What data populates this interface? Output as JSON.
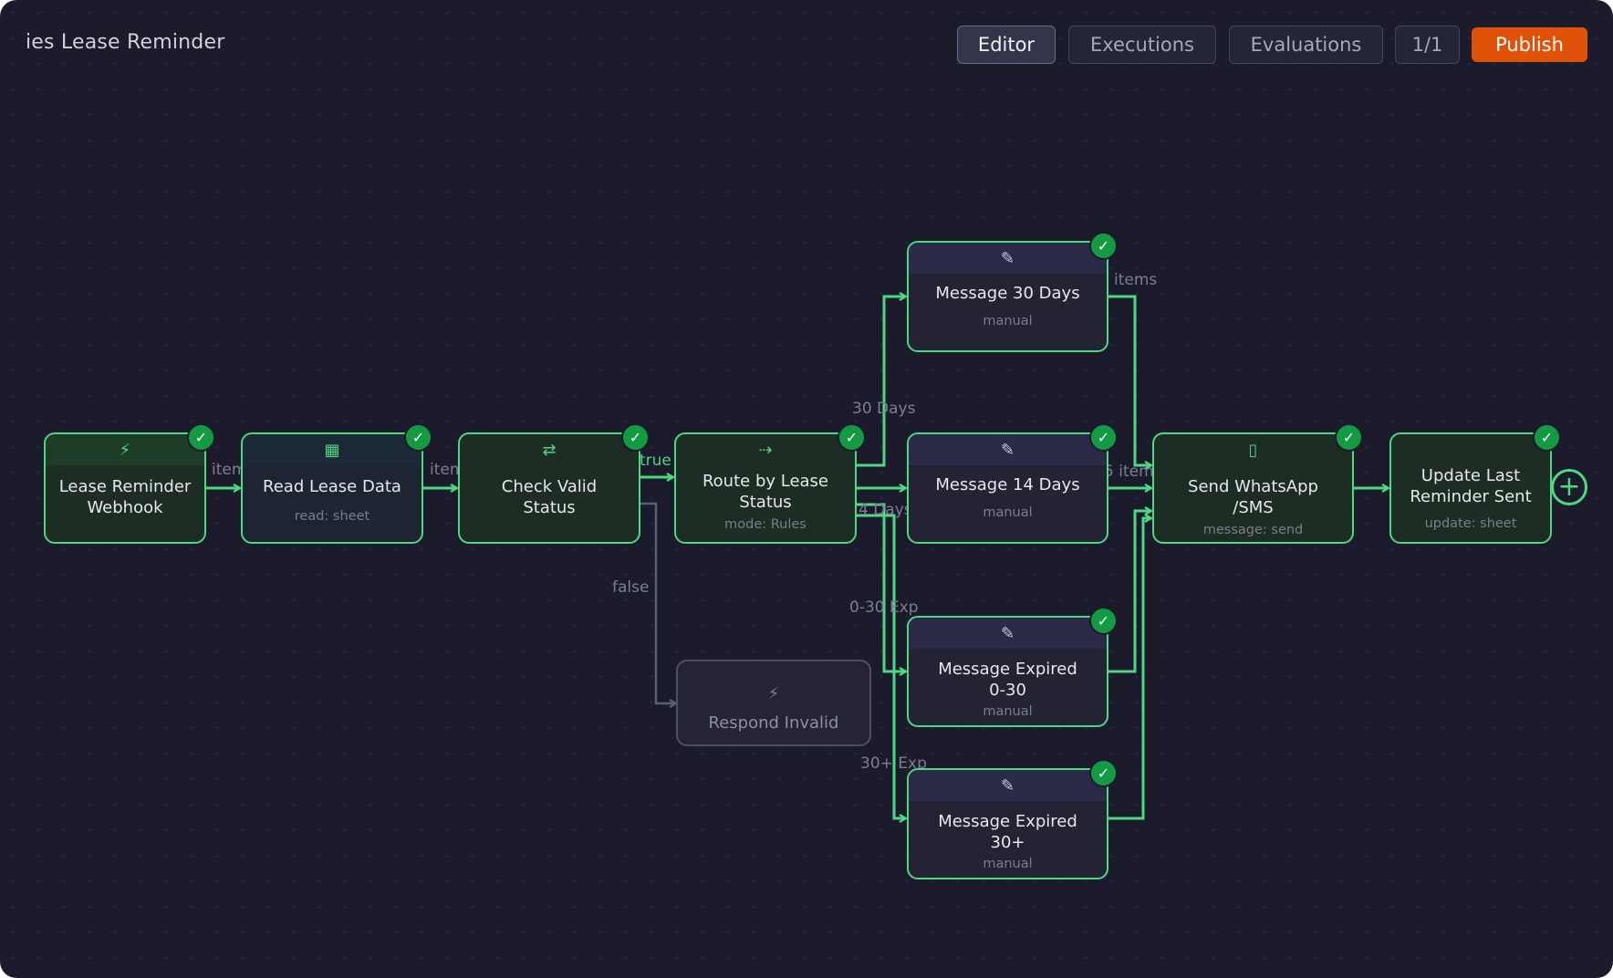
{
  "workflow": {
    "title": "ies Lease Reminder"
  },
  "toolbar": {
    "editor": "Editor",
    "executions": "Executions",
    "evaluations": "Evaluations",
    "pagination": "1/1",
    "publish": "Publish"
  },
  "nodes": {
    "webhook": {
      "icon": "⚡",
      "line1": "Lease Reminder",
      "line2": "Webhook",
      "status": "✓"
    },
    "read": {
      "icon": "▦",
      "name": "Read Lease Data",
      "sub": "read: sheet",
      "status": "✓"
    },
    "check": {
      "icon": "⇄",
      "line1": "Check Valid",
      "line2": "Status",
      "status": "✓"
    },
    "route": {
      "icon": "⇢",
      "line1": "Route by Lease",
      "line2": "Status",
      "sub": "mode: Rules",
      "status": "✓"
    },
    "msg30": {
      "icon": "✎",
      "name": "Message 30 Days",
      "sub": "manual",
      "status": "✓"
    },
    "msg14": {
      "icon": "✎",
      "name": "Message 14 Days",
      "sub": "manual",
      "status": "✓"
    },
    "msgexp": {
      "icon": "✎",
      "line1": "Message Expired",
      "line2": "0-30",
      "sub": "manual",
      "status": "✓"
    },
    "msgexp30": {
      "icon": "✎",
      "line1": "Message Expired",
      "line2": "30+",
      "sub": "manual",
      "status": "✓"
    },
    "send": {
      "icon": "▯",
      "line1": "Send WhatsApp",
      "line2": "/SMS",
      "sub": "message: send",
      "status": "✓"
    },
    "update": {
      "line1": "Update Last",
      "line2": "Reminder Sent",
      "sub": "update: sheet",
      "status": "✓"
    },
    "respond": {
      "icon": "⚡",
      "name": "Respond Invalid"
    }
  },
  "edges": {
    "items_1": "item",
    "items_2": "item",
    "true": "true",
    "false": "false",
    "r30": "30 Days",
    "r14": "4 Days",
    "r0_30": "0-30 Exp",
    "r30plus": "30+ Exp",
    "items_msg": "items",
    "items_send": "5 item"
  },
  "add_button": {
    "glyph": "+"
  },
  "colors": {
    "background": "#1b1b2c",
    "success": "#4ed883",
    "check_badge": "#149a42",
    "publish": "#e0510a",
    "inactive": "#4f4f62"
  }
}
